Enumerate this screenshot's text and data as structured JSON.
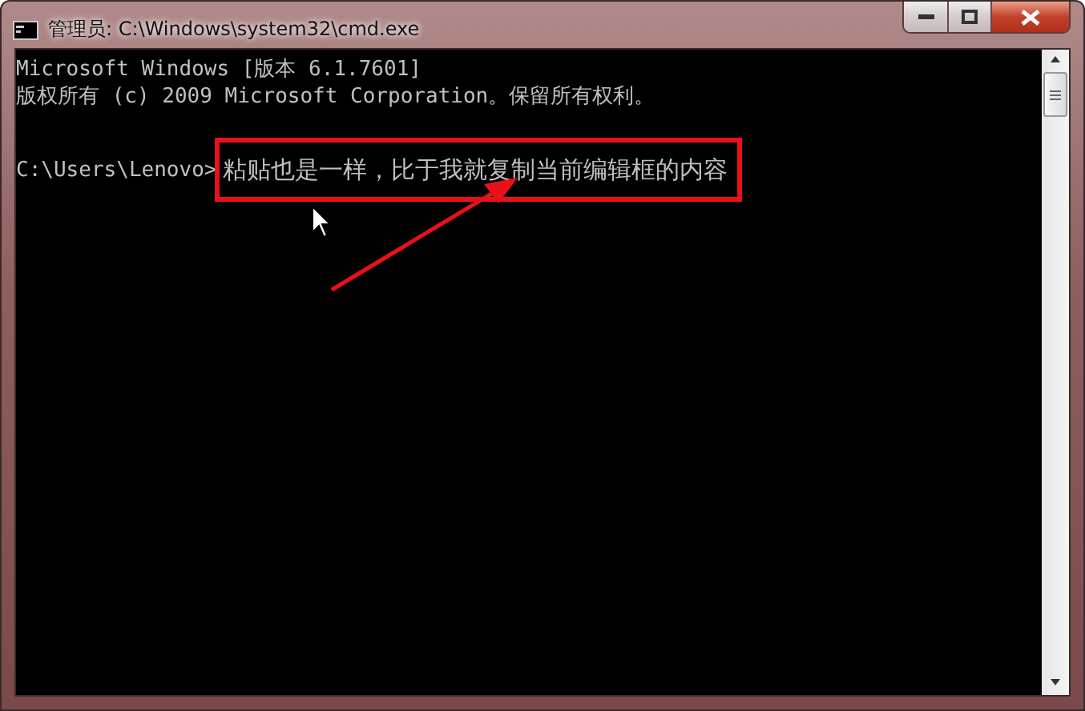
{
  "window": {
    "title": "管理员: C:\\Windows\\system32\\cmd.exe"
  },
  "console": {
    "lines": [
      {
        "text": "Microsoft Windows [版本 6.1.7601]"
      },
      {
        "text": "版权所有 (c) 2009 Microsoft Corporation。保留所有权利。"
      }
    ],
    "prompt": {
      "path": "C:\\Users\\Lenovo>",
      "input": "粘贴也是一样，比于我就复制当前编辑框的内容",
      "highlighted": true
    }
  }
}
